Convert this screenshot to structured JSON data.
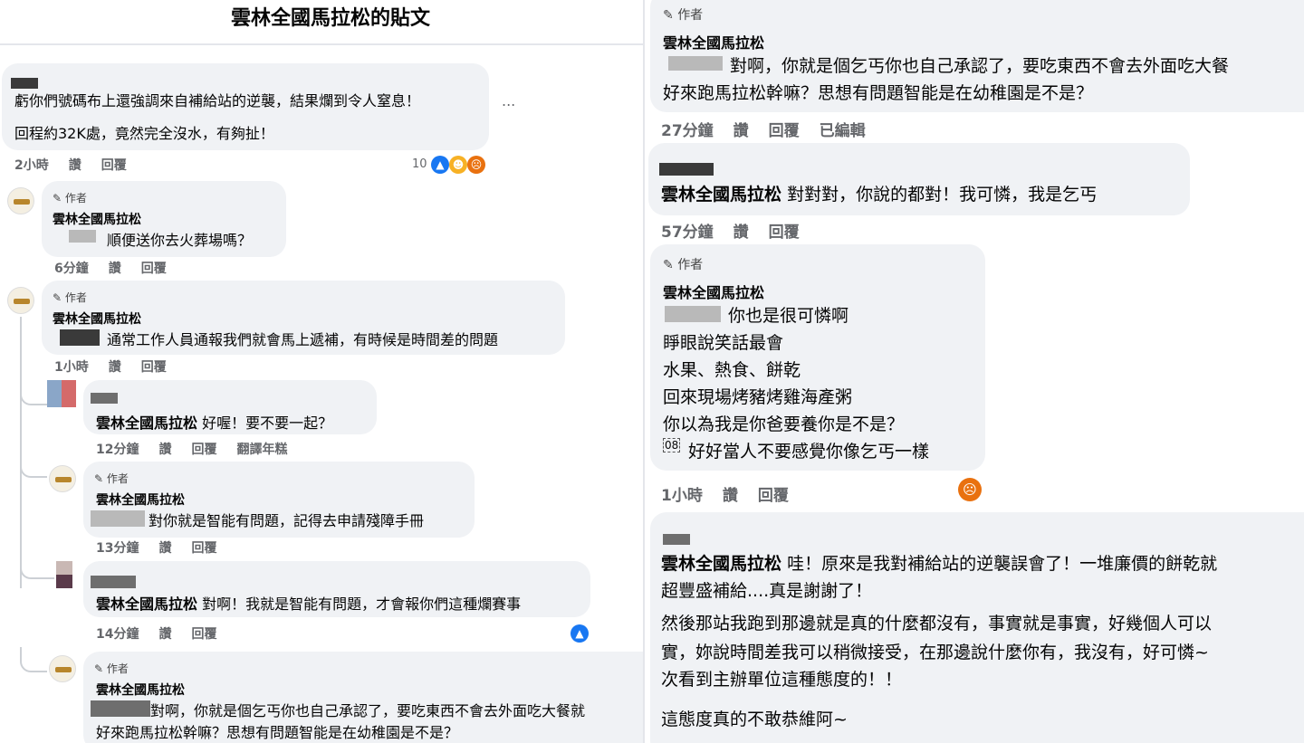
{
  "title": "雲林全國馬拉松的貼文",
  "left": {
    "top_comment": {
      "line1": "虧你們號碼布上還強調來自補給站的逆襲，結果爛到令人窒息！",
      "line2": "回程約32K處，竟然完全沒水，有夠扯！",
      "more": "...",
      "time": "2小時",
      "like": "讚",
      "reply": "回覆",
      "reaction_count": "10"
    },
    "replies": [
      {
        "author": "作者",
        "name": "雲林全國馬拉松",
        "text": "順便送你去火葬場嗎？",
        "time": "6分鐘",
        "like": "讚",
        "reply": "回覆"
      },
      {
        "author": "作者",
        "name": "雲林全國馬拉松",
        "text": "通常工作人員通報我們就會馬上遞補，有時候是時間差的問題",
        "time": "1小時",
        "like": "讚",
        "reply": "回覆"
      },
      {
        "name": "雲林全國馬拉松",
        "text": "好喔！要不要一起？",
        "time": "12分鐘",
        "like": "讚",
        "reply": "回覆",
        "translate": "翻譯年糕"
      },
      {
        "author": "作者",
        "name": "雲林全國馬拉松",
        "text": "對你就是智能有問題，記得去申請殘障手冊",
        "time": "13分鐘",
        "like": "讚",
        "reply": "回覆"
      },
      {
        "name": "雲林全國馬拉松",
        "text": "對啊！我就是智能有問題，才會報你們這種爛賽事",
        "time": "14分鐘",
        "like": "讚",
        "reply": "回覆"
      },
      {
        "author": "作者",
        "name": "雲林全國馬拉松",
        "text1": "對啊，你就是個乞丐你也自己承認了，要吃東西不會去外面吃大餐就",
        "text2": "好來跑馬拉松幹嘛？思想有問題智能是在幼稚園是不是？"
      }
    ]
  },
  "right": {
    "c1": {
      "author": "作者",
      "name": "雲林全國馬拉松",
      "text1": "對啊，你就是個乞丐你也自己承認了，要吃東西不會去外面吃大餐",
      "text2": "好來跑馬拉松幹嘛？思想有問題智能是在幼稚園是不是？",
      "time": "27分鐘",
      "like": "讚",
      "reply": "回覆",
      "edited": "已編輯"
    },
    "c2": {
      "name": "雲林全國馬拉松",
      "text": "對對對，你說的都對！我可憐，我是乞丐",
      "time": "57分鐘",
      "like": "讚",
      "reply": "回覆"
    },
    "c3": {
      "author": "作者",
      "name": "雲林全國馬拉松",
      "lines": [
        "你也是很可憐啊",
        "睜眼說笑話最會",
        "水果、熱食、餅乾",
        "回來現場烤豬烤雞海產粥",
        "你以為我是你爸要養你是不是？",
        "好好當人不要感覺你像乞丐一樣"
      ],
      "prefix_last": "08",
      "time": "1小時",
      "like": "讚",
      "reply": "回覆"
    },
    "c4": {
      "name": "雲林全國馬拉松",
      "line1": "哇！原來是我對補給站的逆襲誤會了！一堆廉價的餅乾就",
      "line2": "超豐盛補給....真是謝謝了！",
      "line3": "然後那站我跑到那邊就是真的什麼都沒有，事實就是事實，好幾個人可以",
      "line4": "實，妳說時間差我可以稍微接受，在那邊說什麼你有，我沒有，好可憐~",
      "line5": "次看到主辦單位這種態度的！！",
      "line6": "這態度真的不敢恭維阿~"
    }
  }
}
